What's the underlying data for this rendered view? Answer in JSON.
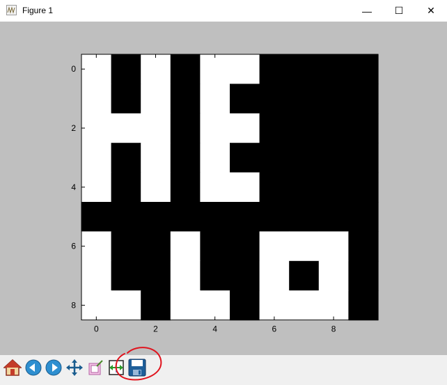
{
  "window": {
    "title": "Figure 1",
    "controls": {
      "minimize": "—",
      "maximize": "☐",
      "close": "✕"
    }
  },
  "figure": {
    "canvas_color": "#bfbfbf",
    "axes": {
      "xticks": [
        "0",
        "2",
        "4",
        "6",
        "8"
      ],
      "yticks": [
        "0",
        "2",
        "4",
        "6",
        "8"
      ]
    }
  },
  "chart_data": {
    "type": "heatmap",
    "colormap": "gray (0 = black, 1 = white)",
    "rows": 9,
    "cols": 10,
    "xlim": [
      -0.5,
      9.5
    ],
    "ylim": [
      8.5,
      -0.5
    ],
    "xticks": [
      0,
      2,
      4,
      6,
      8
    ],
    "yticks": [
      0,
      2,
      4,
      6,
      8
    ],
    "grid": false,
    "values": [
      [
        1,
        0,
        1,
        0,
        1,
        1,
        0,
        0,
        0,
        0
      ],
      [
        1,
        0,
        1,
        0,
        1,
        0,
        0,
        0,
        0,
        0
      ],
      [
        1,
        1,
        1,
        0,
        1,
        1,
        0,
        0,
        0,
        0
      ],
      [
        1,
        0,
        1,
        0,
        1,
        0,
        0,
        0,
        0,
        0
      ],
      [
        1,
        0,
        1,
        0,
        1,
        1,
        0,
        0,
        0,
        0
      ],
      [
        0,
        0,
        0,
        0,
        0,
        0,
        0,
        0,
        0,
        0
      ],
      [
        1,
        0,
        0,
        1,
        0,
        0,
        1,
        1,
        1,
        0
      ],
      [
        1,
        0,
        0,
        1,
        0,
        0,
        1,
        0,
        1,
        0
      ],
      [
        1,
        1,
        0,
        1,
        1,
        0,
        1,
        1,
        1,
        0
      ]
    ]
  },
  "toolbar": {
    "buttons": [
      {
        "name": "home-icon"
      },
      {
        "name": "back-icon"
      },
      {
        "name": "forward-icon"
      },
      {
        "name": "pan-icon"
      },
      {
        "name": "zoom-icon"
      },
      {
        "name": "subplots-icon"
      },
      {
        "name": "save-icon"
      }
    ],
    "annotation_color": "#e0141e"
  }
}
